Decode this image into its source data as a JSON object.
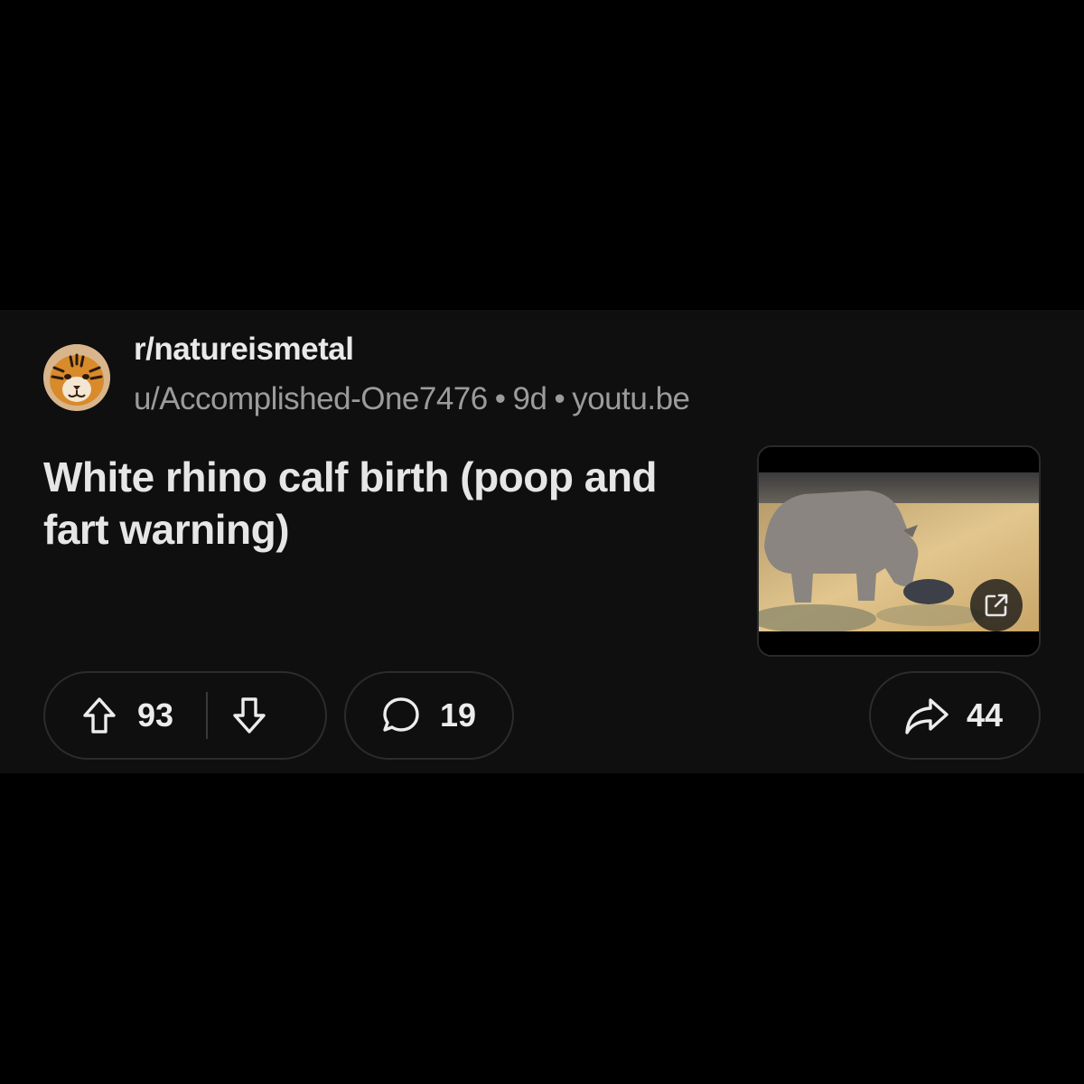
{
  "post": {
    "subreddit": "r/natureismetal",
    "author": "u/Accomplished-One7476",
    "age": "9d",
    "domain": "youtu.be",
    "separator": "•",
    "title": "White rhino calf birth (poop and fart warning)"
  },
  "actions": {
    "upvotes": "93",
    "comments": "19",
    "shares": "44"
  },
  "icons": {
    "avatar": "tiger-avatar",
    "upvote": "arrow-up-icon",
    "downvote": "arrow-down-icon",
    "comment": "comment-bubble-icon",
    "share": "share-arrow-icon",
    "external_link": "external-link-icon"
  },
  "colors": {
    "background": "#000000",
    "card": "#0f0f10",
    "text_primary": "#e9e9e9",
    "text_secondary": "#9b9b9b",
    "pill_border": "#2c2c2e"
  }
}
